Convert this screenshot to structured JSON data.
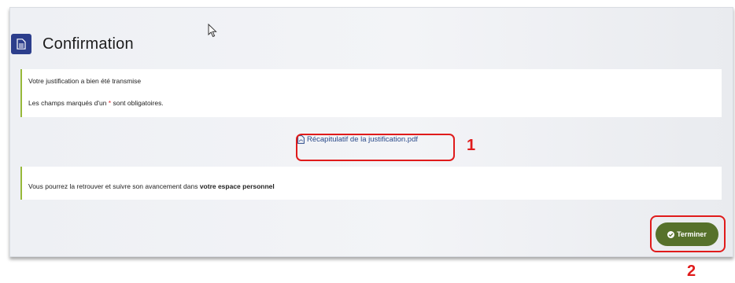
{
  "header": {
    "title": "Confirmation",
    "icon": "document-icon"
  },
  "info_box": {
    "line1": "Votre justification a bien été transmise",
    "line2_prefix": "Les champs marqués d'un ",
    "line2_star": "*",
    "line2_suffix": " sont obligatoires."
  },
  "download": {
    "label": "Récapitulatif de la justification.pdf",
    "icon": "pdf-file-icon"
  },
  "annotations": {
    "callout1": "1",
    "callout2": "2",
    "color": "#e01b1b"
  },
  "notice_box": {
    "text_prefix": "Vous pourrez la retrouver et suivre son avancement dans ",
    "text_bold": "votre espace personnel"
  },
  "finish_button": {
    "label": "Terminer",
    "icon": "check-circle-icon",
    "color": "#56712b"
  },
  "colors": {
    "accent_blue": "#2c3e8c",
    "accent_green": "#97b93a"
  }
}
